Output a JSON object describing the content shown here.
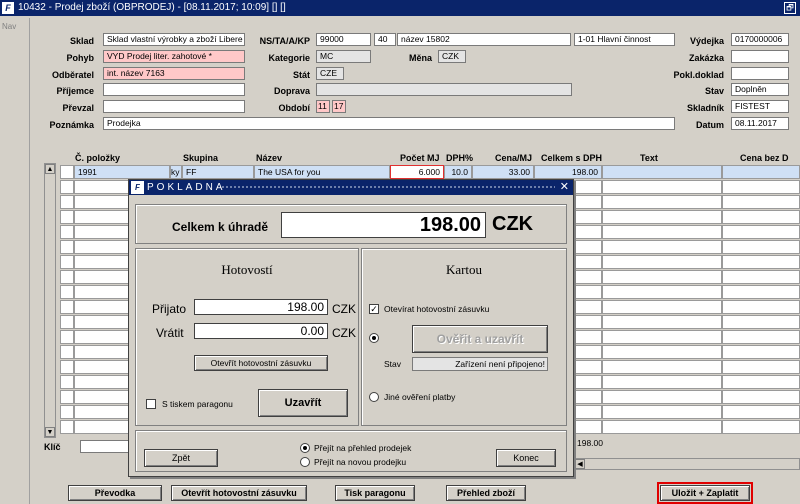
{
  "window": {
    "title": "10432 - Prodej zboží (OBPRODEJ) - [08.11.2017; 10:09] [] []",
    "icon": "app-logo-icon",
    "restore": "🗗"
  },
  "nav": {
    "label": "Nav"
  },
  "header": {
    "sklad": {
      "label": "Sklad",
      "value": "Sklad vlastní výrobky a zboží Libere"
    },
    "pohyb": {
      "label": "Pohyb",
      "value": "VYD Prodej liter. zahotové *"
    },
    "odberatel": {
      "label": "Odběratel",
      "value": "int. název 7163"
    },
    "prijemce": {
      "label": "Příjemce",
      "value": ""
    },
    "prevzal": {
      "label": "Převzal",
      "value": ""
    },
    "poznamka": {
      "label": "Poznámka",
      "value": "Prodejka"
    },
    "ns": {
      "label": "NS/TA/A/KP",
      "v1": "99000",
      "v2": "40",
      "v3": "název 15802",
      "v4": "1-01 Hlavní činnost"
    },
    "kategorie": {
      "label": "Kategorie",
      "value": "MC"
    },
    "mena": {
      "label": "Měna",
      "value": "CZK"
    },
    "stat": {
      "label": "Stát",
      "value": "CZE"
    },
    "doprava": {
      "label": "Doprava",
      "value": ""
    },
    "obdobi": {
      "label": "Období",
      "v1": "11",
      "v2": "17"
    },
    "vydejka": {
      "label": "Výdejka",
      "value": "0170000006"
    },
    "zakazka": {
      "label": "Zakázka",
      "value": ""
    },
    "pokl_doklad": {
      "label": "Pokl.doklad",
      "value": ""
    },
    "stav": {
      "label": "Stav",
      "value": "Doplněn"
    },
    "skladnik": {
      "label": "Skladník",
      "value": "FISTEST"
    },
    "datum": {
      "label": "Datum",
      "value": "08.11.2017"
    }
  },
  "grid": {
    "columns": [
      "Č. položky",
      "Skupina",
      "Název",
      "Počet MJ",
      "DPH%",
      "Cena/MJ",
      "Celkem s DPH",
      "Text",
      "Cena bez D"
    ],
    "row1": {
      "polozka": "1991",
      "mark": "ky",
      "skupina": "FF",
      "nazev": "The USA for you",
      "pocet": "6.000",
      "dph": "10.0",
      "cena": "33.00",
      "celkem": "198.00"
    },
    "klic_label": "Klíč",
    "sum_total": "198.00"
  },
  "buttons": {
    "prevodka": "Převodka",
    "otevrit": "Otevřít hotovostní zásuvku",
    "tisk": "Tisk paragonu",
    "prehled": "Přehled zboží",
    "ulozit": "Uložit + Zaplatit"
  },
  "dialog": {
    "title": "POKLADNA",
    "icon": "app-logo-icon",
    "close": "✕",
    "total_label": "Celkem k úhradě",
    "total_value": "198.00",
    "currency": "CZK",
    "hotovost": {
      "title": "Hotovostí",
      "prijato_label": "Přijato",
      "prijato_value": "198.00",
      "prijato_cur": "CZK",
      "vratit_label": "Vrátit",
      "vratit_value": "0.00",
      "vratit_cur": "CZK",
      "open_drawer_btn": "Otevřít hotovostní zásuvku",
      "print_label": "S tiskem paragonu",
      "close_btn": "Uzavřít"
    },
    "kartou": {
      "title": "Kartou",
      "open_drawer_label": "Otevírat hotovostní zásuvku",
      "verify_btn": "Ověřit a uzavřít",
      "stav_label": "Stav",
      "stav_value": "Zařízení není připojeno!",
      "other_label": "Jiné ověření platby"
    },
    "footer": {
      "back_btn": "Zpět",
      "radio1": "Přejít na přehled prodejek",
      "radio2": "Přejít na novou prodejku",
      "end_btn": "Konec"
    }
  }
}
